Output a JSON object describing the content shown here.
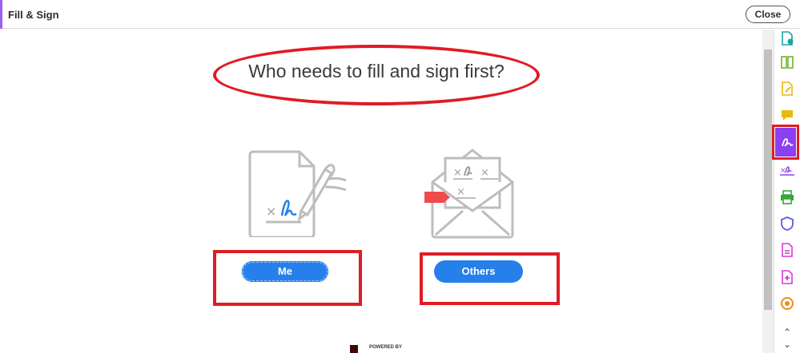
{
  "header": {
    "title": "Fill & Sign",
    "close_label": "Close",
    "accent_color": "#9d5ff5"
  },
  "main": {
    "heading": "Who needs to fill and sign first?",
    "me_label": "Me",
    "others_label": "Others",
    "button_color": "#2680eb",
    "annotation_color": "#e01b24",
    "powered_by": "POWERED BY"
  },
  "tools": [
    {
      "icon": "export-pdf-icon",
      "color": "#1aa3a3"
    },
    {
      "icon": "organize-pages-icon",
      "color": "#6fb42c"
    },
    {
      "icon": "edit-pdf-icon",
      "color": "#e8b90b"
    },
    {
      "icon": "comment-icon",
      "color": "#e8b90b"
    },
    {
      "icon": "fill-sign-icon",
      "color": "#ffffff"
    },
    {
      "icon": "request-signature-icon",
      "color": "#8a3ff0"
    },
    {
      "icon": "print-production-icon",
      "color": "#3aa63a"
    },
    {
      "icon": "protect-icon",
      "color": "#5c5ce0"
    },
    {
      "icon": "create-pdf-icon",
      "color": "#d63ad6"
    },
    {
      "icon": "combine-files-icon",
      "color": "#d63ad6"
    },
    {
      "icon": "action-wizard-icon",
      "color": "#f08c1a"
    }
  ]
}
